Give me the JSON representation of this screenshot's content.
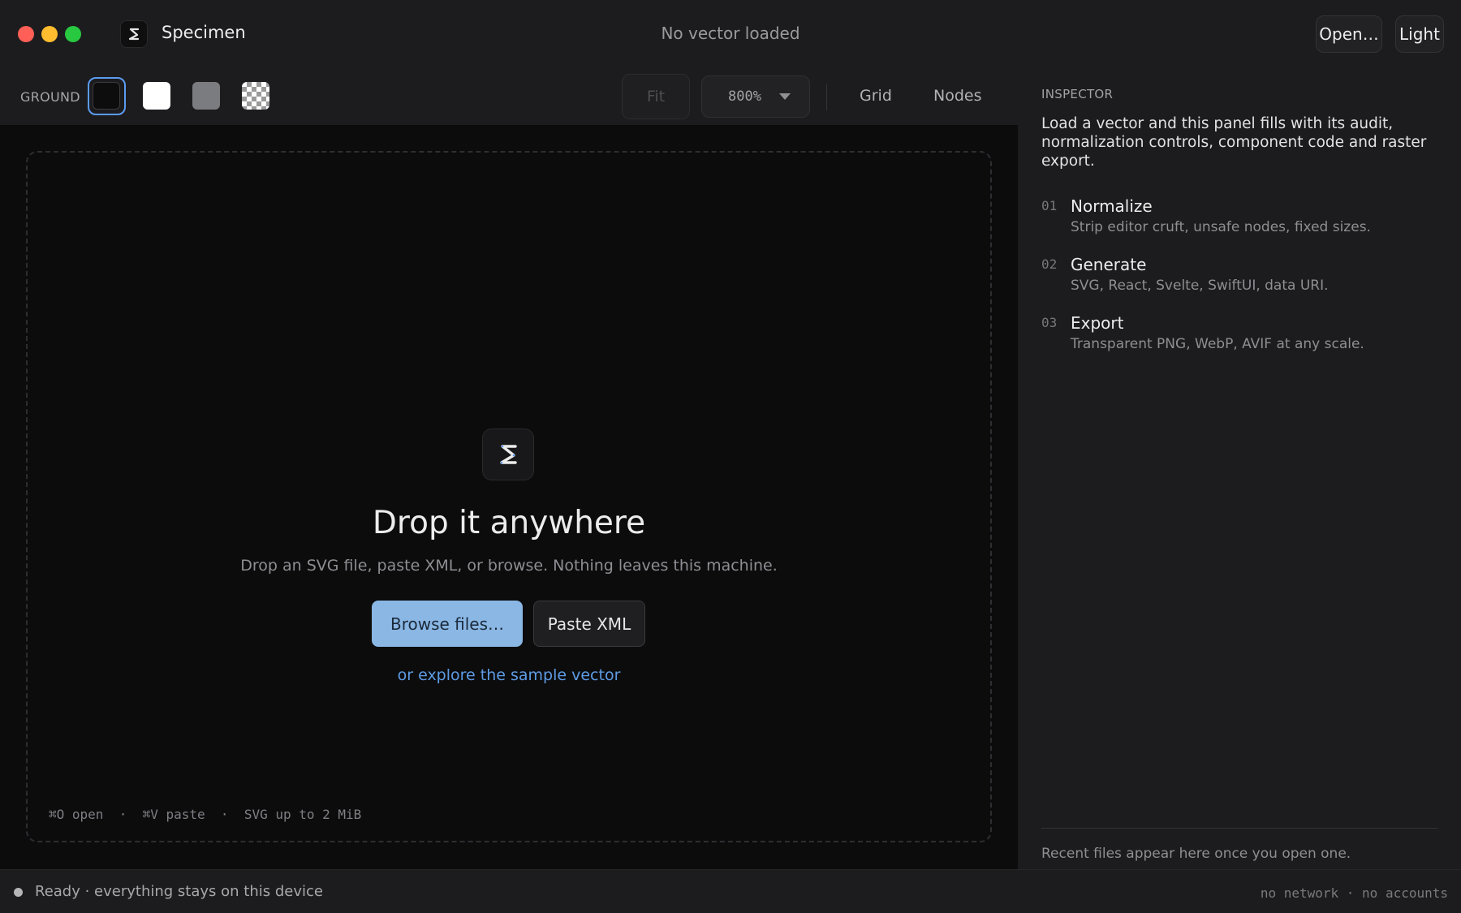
{
  "app": {
    "name": "Specimen",
    "document_title": "No vector loaded"
  },
  "titlebar": {
    "open_label": "Open…",
    "theme_label": "Light"
  },
  "toolbar": {
    "ground_label": "GROUND",
    "grounds": [
      "black",
      "white",
      "gray",
      "checkerboard"
    ],
    "selected_ground": "black",
    "fit_label": "Fit",
    "zoom_value": "800%",
    "grid_label": "Grid",
    "nodes_label": "Nodes"
  },
  "canvas": {
    "title": "Drop it anywhere",
    "subtitle": "Drop an SVG file, paste XML, or browse. Nothing leaves this machine.",
    "browse_label": "Browse files…",
    "paste_label": "Paste XML",
    "sample_link": "or explore the sample vector",
    "hint": "⌘O open  ·  ⌘V paste  ·  SVG up to 2 MiB"
  },
  "inspector": {
    "heading": "INSPECTOR",
    "intro": "Load a vector and this panel fills with its audit, normalization controls, component code and raster export.",
    "steps": [
      {
        "num": "01",
        "title": "Normalize",
        "desc": "Strip editor cruft, unsafe nodes, fixed sizes."
      },
      {
        "num": "02",
        "title": "Generate",
        "desc": "SVG, React, Svelte, SwiftUI, data URI."
      },
      {
        "num": "03",
        "title": "Export",
        "desc": "Transparent PNG, WebP, AVIF at any scale."
      }
    ],
    "recent": "Recent files appear here once you open one."
  },
  "status": {
    "text": "Ready · everything stays on this device",
    "right": "no network · no accounts"
  },
  "colors": {
    "accent": "#5b9bf0",
    "primary_button": "#8ab7e4",
    "link": "#5e9be3",
    "canvas_bg": "#0c0c0d",
    "chrome_bg": "#1c1c1e"
  },
  "icons": [
    "close-icon",
    "minimize-icon",
    "zoom-icon",
    "specimen-logo-icon",
    "chevron-down-icon",
    "status-dot-icon"
  ]
}
